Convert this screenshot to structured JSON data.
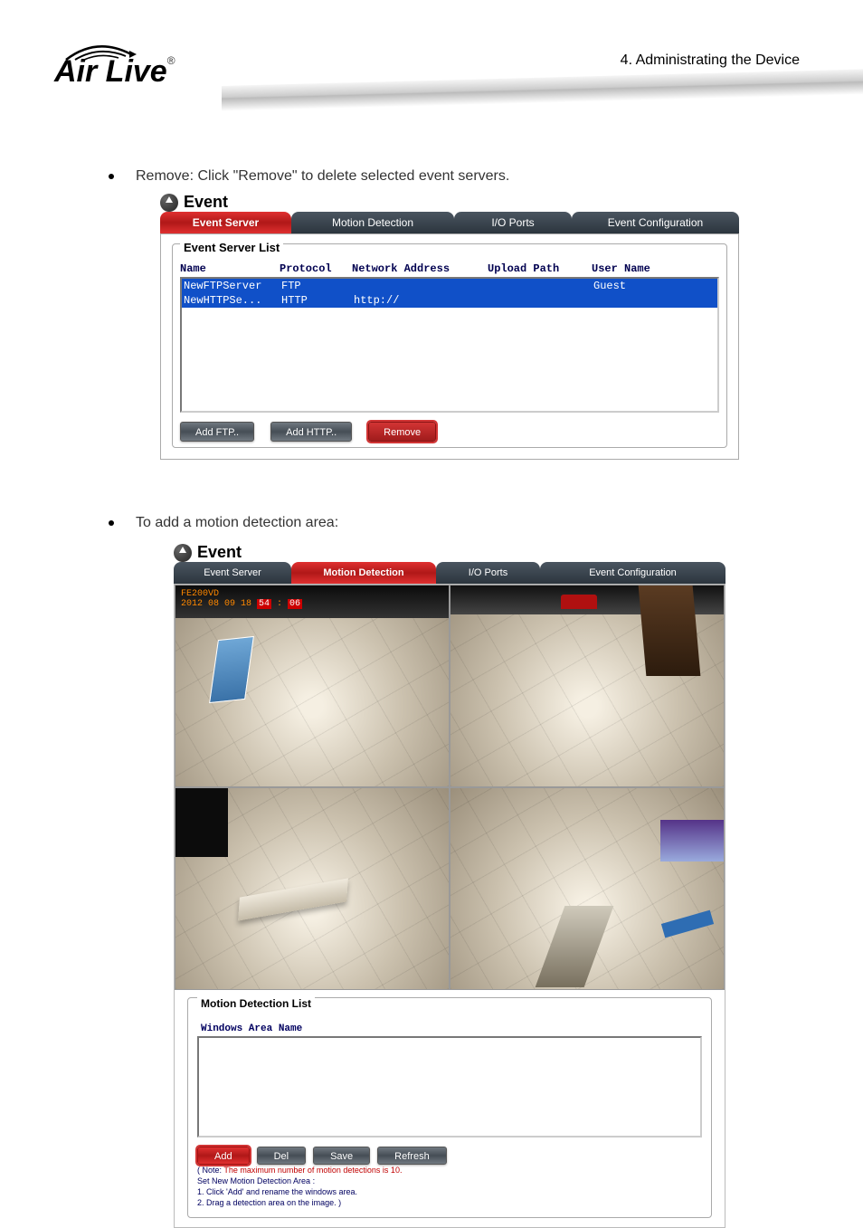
{
  "header": {
    "logo_text": "Air Live",
    "chapter": "4.  Administrating  the  Device"
  },
  "bullets": {
    "b1": "Remove: Click \"Remove\" to delete selected event servers.",
    "b2": "To add a motion detection area:"
  },
  "shot1": {
    "title": "Event",
    "tabs": {
      "t1": "Event Server",
      "t2": "Motion Detection",
      "t3": "I/O Ports",
      "t4": "Event Configuration"
    },
    "fieldset_label": "Event Server List",
    "cols": {
      "c1": "Name",
      "c2": "Protocol",
      "c3": "Network Address",
      "c4": "Upload Path",
      "c5": "User Name"
    },
    "rows": [
      {
        "name": "NewFTPServer",
        "protocol": "FTP",
        "addr": "",
        "path": "",
        "user": "Guest"
      },
      {
        "name": "NewHTTPSe...",
        "protocol": "HTTP",
        "addr": "http://",
        "path": "",
        "user": ""
      }
    ],
    "buttons": {
      "b1": "Add FTP..",
      "b2": "Add HTTP..",
      "b3": "Remove"
    }
  },
  "shot2": {
    "title": "Event",
    "tabs": {
      "t1": "Event Server",
      "t2": "Motion Detection",
      "t3": "I/O Ports",
      "t4": "Event Configuration"
    },
    "osd": {
      "line1": "FE200VD",
      "date": "2012 08 09 18 ",
      "time_a": "54",
      "colon": " : ",
      "time_b": "06"
    },
    "mdl_label": "Motion Detection List",
    "mdl_header": "Windows Area Name",
    "buttons": {
      "b1": "Add",
      "b2": "Del",
      "b3": "Save",
      "b4": "Refresh"
    },
    "note": {
      "l1a": "( Note: ",
      "l1b": "The maximum number of motion detections is 10.",
      "l2": "Set New Motion Detection Area :",
      "l3": "1. Click 'Add' and rename the windows area.",
      "l4": "2. Drag a detection area on the image. )"
    }
  }
}
